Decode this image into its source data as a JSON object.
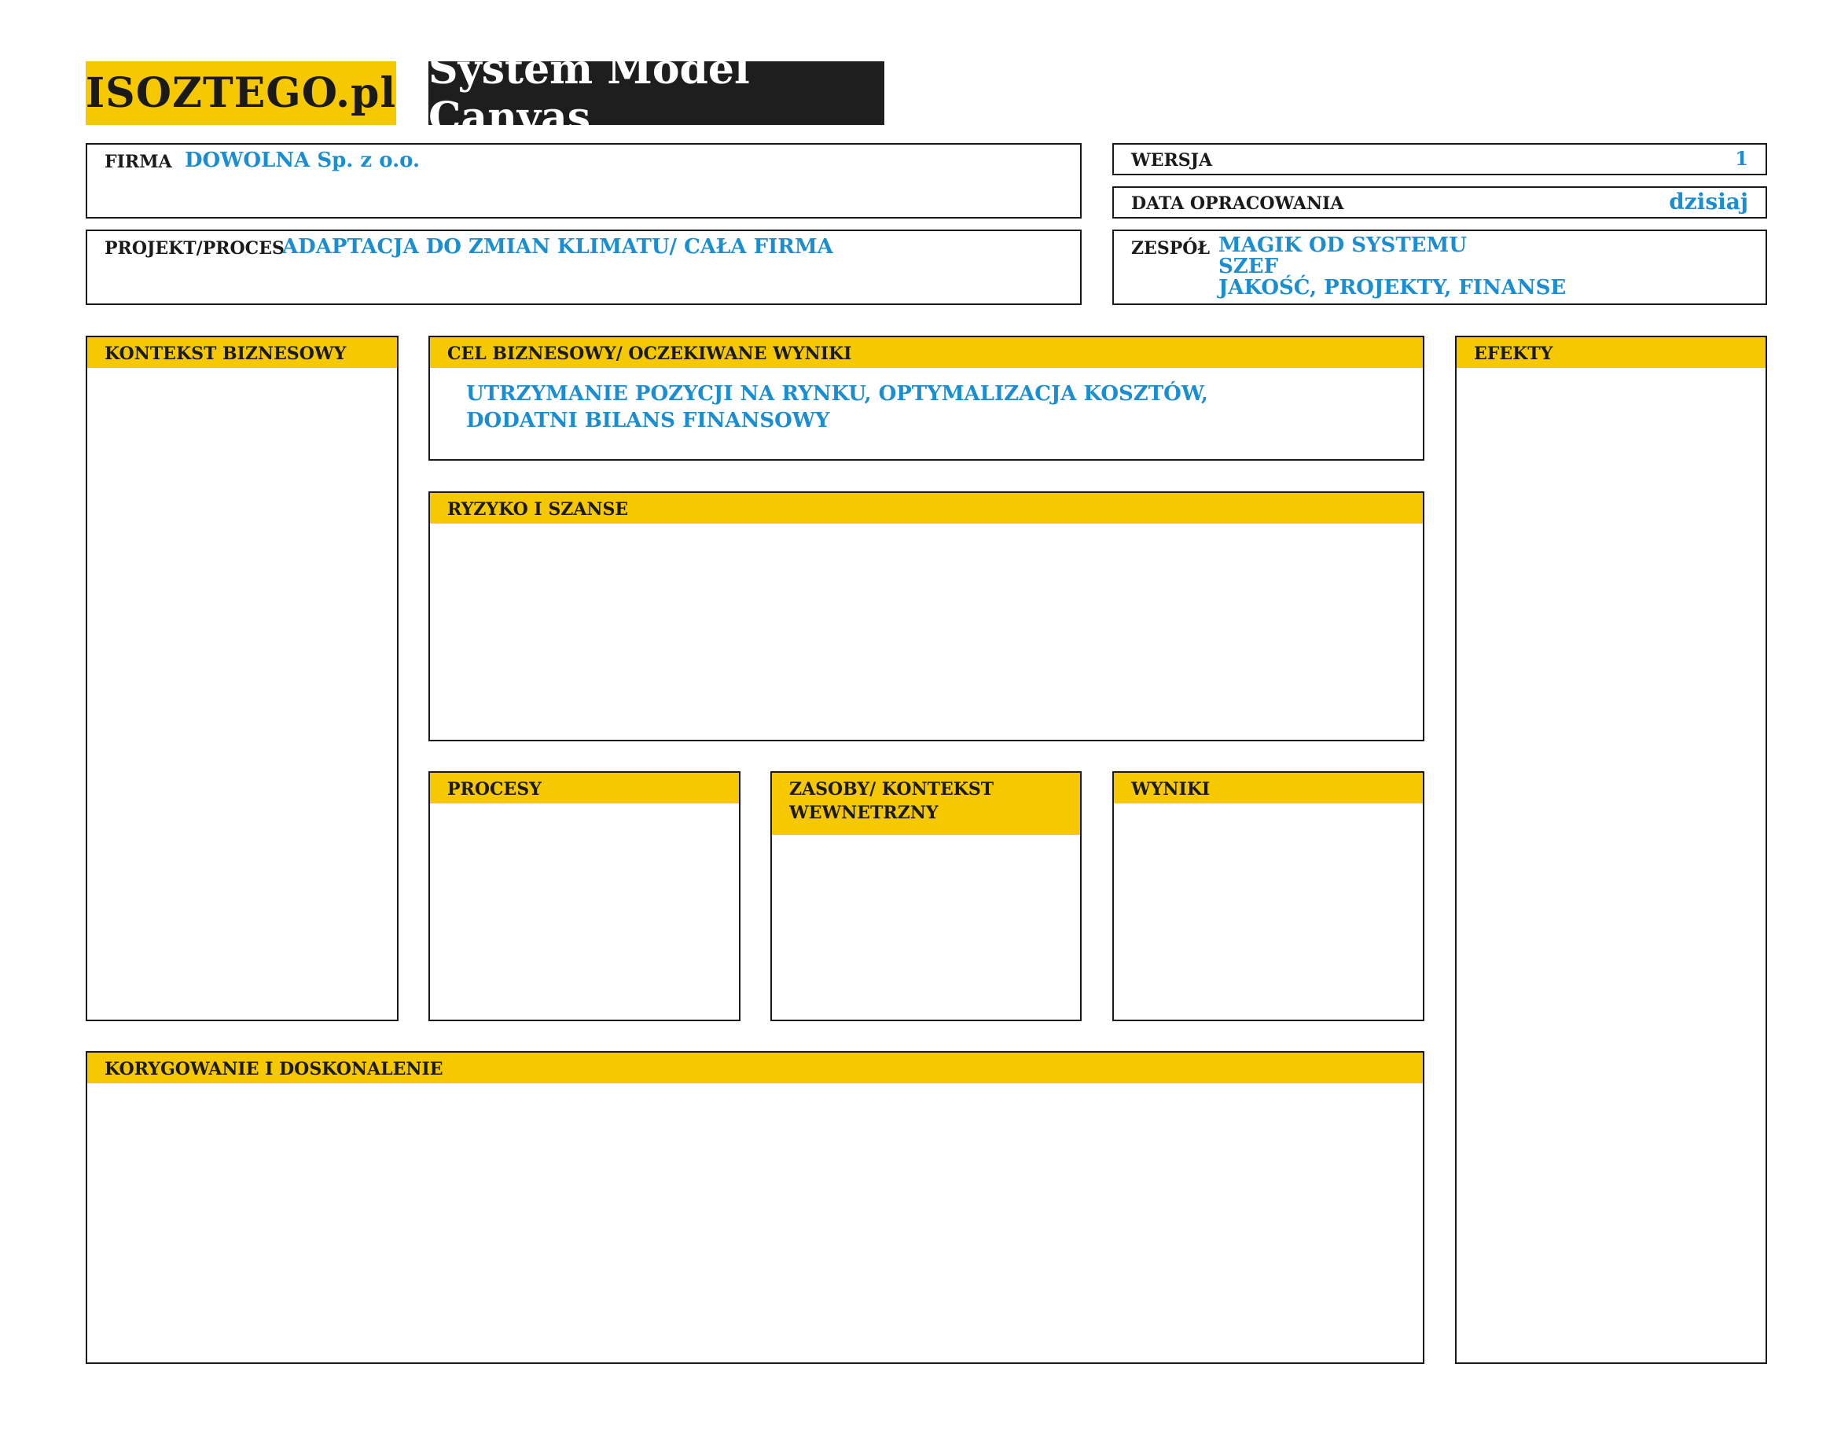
{
  "header": {
    "logo": "ISOZTEGO.pl",
    "title": "System Model Canvas"
  },
  "info": {
    "firma": {
      "label": "FIRMA",
      "value": "DOWOLNA Sp. z o.o."
    },
    "projekt": {
      "label": "PROJEKT/PROCES",
      "value": "ADAPTACJA DO ZMIAN KLIMATU/ CAŁA FIRMA"
    },
    "wersja": {
      "label": "WERSJA",
      "value": "1"
    },
    "data": {
      "label": "DATA OPRACOWANIA",
      "value": "dzisiaj"
    },
    "zespol": {
      "label": "ZESPÓŁ",
      "members": [
        "MAGIK OD SYSTEMU",
        "SZEF",
        "JAKOŚĆ, PROJEKTY, FINANSE"
      ]
    }
  },
  "sections": {
    "kontekst": {
      "title": "KONTEKST BIZNESOWY"
    },
    "cel": {
      "title": "CEL BIZNESOWY/ OCZEKIWANE WYNIKI",
      "lines": [
        "UTRZYMANIE POZYCJI NA RYNKU, OPTYMALIZACJA KOSZTÓW,",
        "DODATNI BILANS FINANSOWY"
      ]
    },
    "efekty": {
      "title": "EFEKTY"
    },
    "ryzyko": {
      "title": "RYZYKO I SZANSE"
    },
    "procesy": {
      "title": "PROCESY"
    },
    "zasoby": {
      "title_lines": [
        "ZASOBY/ KONTEKST",
        "WEWNETRZNY"
      ]
    },
    "wyniki": {
      "title": "WYNIKI"
    },
    "korygowanie": {
      "title": "KORYGOWANIE I DOSKONALENIE"
    }
  },
  "colors": {
    "accent": "#f5c800",
    "dark": "#1e1e1e",
    "value_text": "#1a8ed0"
  }
}
